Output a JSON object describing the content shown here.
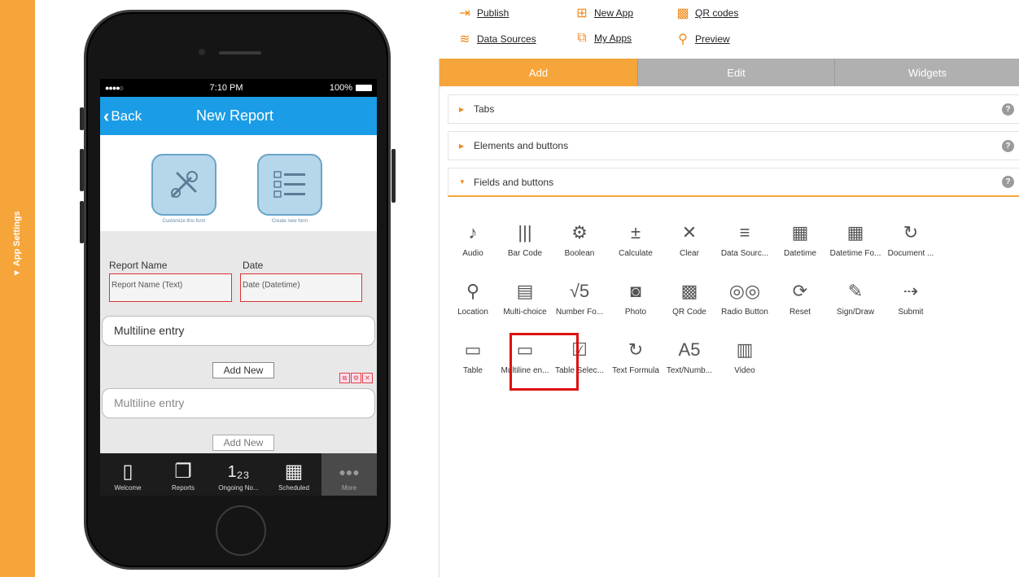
{
  "sidebar": {
    "label": "▼ App Settings"
  },
  "phone": {
    "status": {
      "signal": "●●●●○",
      "time": "7:10 PM",
      "battery": "100%"
    },
    "nav": {
      "back": "Back",
      "title": "New Report"
    },
    "hero": {
      "tile1_caption": "Customize this form",
      "tile2_caption": "Create new form"
    },
    "form": {
      "report_name_label": "Report Name",
      "report_name_value": "Report Name (Text)",
      "date_label": "Date",
      "date_value": "Date (Datetime)",
      "multiline_1": "Multiline entry",
      "add_new_1": "Add New",
      "multiline_2": "Multiline entry",
      "add_new_2": "Add New"
    },
    "tabbar": [
      {
        "label": "Welcome",
        "icon": "phone-icon"
      },
      {
        "label": "Reports",
        "icon": "documents-icon"
      },
      {
        "label": "Ongoing No...",
        "icon": "numbers-icon"
      },
      {
        "label": "Scheduled",
        "icon": "calendar-icon"
      },
      {
        "label": "More",
        "icon": "more-icon"
      }
    ]
  },
  "toolbar": {
    "publish": "Publish",
    "new_app": "New App",
    "qr_codes": "QR codes",
    "data_sources": "Data Sources",
    "my_apps": "My Apps",
    "preview": "Preview"
  },
  "panel": {
    "tabs": {
      "add": "Add",
      "edit": "Edit",
      "widgets": "Widgets"
    },
    "sections": {
      "tabs": "Tabs",
      "elements": "Elements and buttons",
      "fields": "Fields and buttons"
    },
    "help": "?",
    "widgets": [
      {
        "label": "Audio",
        "icon": "music-note-icon"
      },
      {
        "label": "Bar Code",
        "icon": "barcode-icon"
      },
      {
        "label": "Boolean",
        "icon": "toggle-icon"
      },
      {
        "label": "Calculate",
        "icon": "calculator-icon"
      },
      {
        "label": "Clear",
        "icon": "clear-icon"
      },
      {
        "label": "Data Sourc...",
        "icon": "data-source-icon"
      },
      {
        "label": "Datetime",
        "icon": "datetime-icon"
      },
      {
        "label": "Datetime Fo...",
        "icon": "datetime-formula-icon"
      },
      {
        "label": "Document ...",
        "icon": "document-upload-icon"
      },
      {
        "label": "Location",
        "icon": "location-pin-icon"
      },
      {
        "label": "Multi-choice",
        "icon": "multi-choice-icon"
      },
      {
        "label": "Number Fo...",
        "icon": "sqrt-icon"
      },
      {
        "label": "Photo",
        "icon": "camera-icon"
      },
      {
        "label": "QR Code",
        "icon": "qr-code-icon"
      },
      {
        "label": "Radio Button",
        "icon": "radio-button-icon"
      },
      {
        "label": "Reset",
        "icon": "reset-icon"
      },
      {
        "label": "Sign/Draw",
        "icon": "pen-icon"
      },
      {
        "label": "Submit",
        "icon": "submit-arrow-icon"
      },
      {
        "label": "Table",
        "icon": "table-icon"
      },
      {
        "label": "Multiline en...",
        "icon": "multiline-entry-icon"
      },
      {
        "label": "Table Selec...",
        "icon": "table-select-icon"
      },
      {
        "label": "Text Formula",
        "icon": "text-formula-icon"
      },
      {
        "label": "Text/Numb...",
        "icon": "text-number-icon"
      },
      {
        "label": "Video",
        "icon": "video-icon"
      }
    ],
    "widget_glyphs": [
      "♪",
      "|||",
      "⚙",
      "±",
      "✕",
      "≡",
      "▦",
      "▦",
      "↻",
      "⚲",
      "▤",
      "√5",
      "◙",
      "▩",
      "◎◎",
      "⟳",
      "✎",
      "⇢",
      "▭",
      "▭",
      "☑",
      "↻",
      "A5",
      "▥"
    ]
  },
  "colors": {
    "accent": "#f6a53a",
    "nav_blue": "#1a9ce6",
    "highlight": "#dd1111"
  }
}
